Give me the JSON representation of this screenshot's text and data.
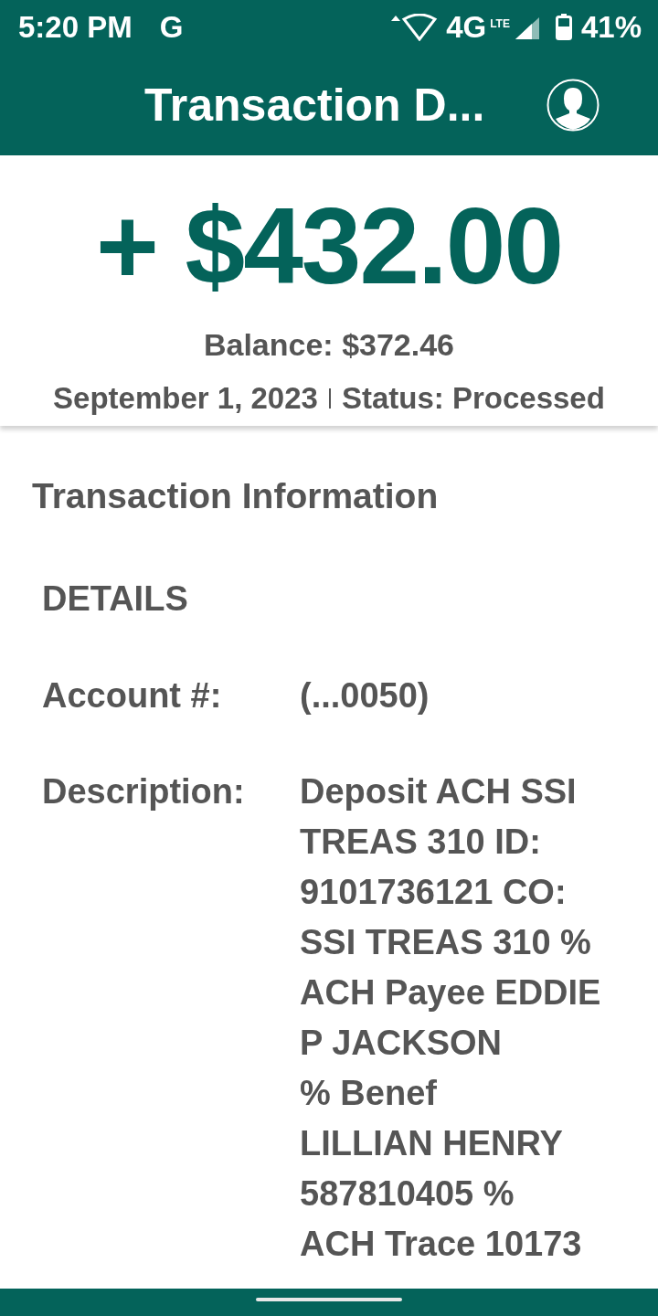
{
  "status_bar": {
    "time": "5:20 PM",
    "app_letter": "G",
    "network": "4G",
    "network_sub": "LTE",
    "battery": "41%"
  },
  "app_bar": {
    "title": "Transaction D..."
  },
  "summary": {
    "amount": "+ $432.00",
    "balance": "Balance: $372.46",
    "date": "September 1, 2023",
    "status": "Status: Processed"
  },
  "section_title": "Transaction Information",
  "details_heading": "DETAILS",
  "fields": [
    {
      "label": "Account #:",
      "value_lines": [
        "(...0050)"
      ]
    },
    {
      "label": "Description:",
      "value_lines": [
        "Deposit ACH SSI",
        "TREAS 310 ID:",
        "9101736121 CO:",
        "SSI TREAS 310 %",
        "ACH Payee EDDIE",
        "P JACKSON",
        "% Benef",
        "LILLIAN HENRY",
        "587810405 %",
        "ACH Trace 10173"
      ]
    }
  ]
}
